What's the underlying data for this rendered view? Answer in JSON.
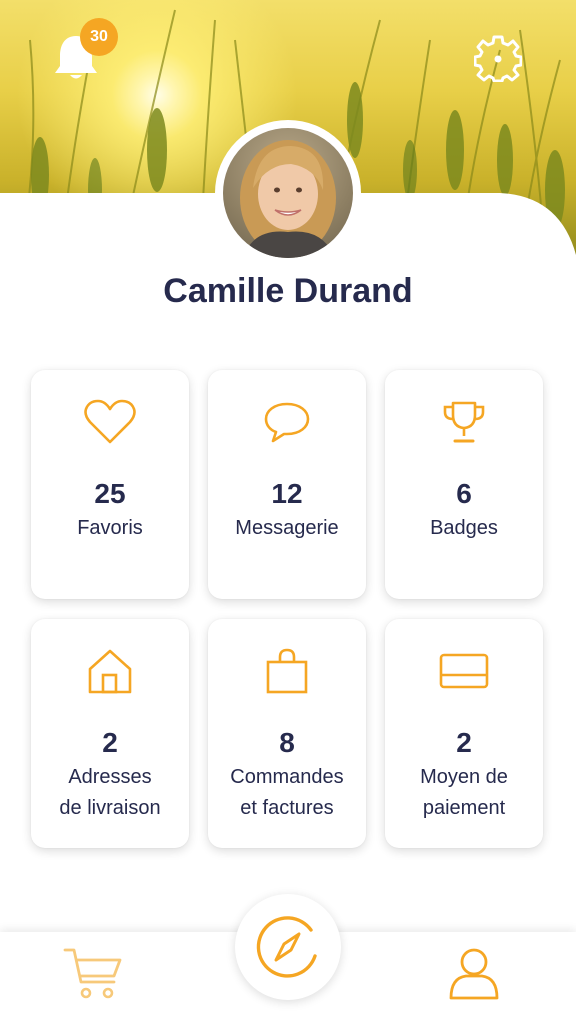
{
  "header": {
    "notifications_count": "30",
    "bell_icon": "bell-icon",
    "settings_icon": "gear-icon"
  },
  "profile": {
    "name": "Camille Durand"
  },
  "stats": [
    {
      "icon": "heart-icon",
      "count": "25",
      "label": "Favoris"
    },
    {
      "icon": "chat-bubble-icon",
      "count": "12",
      "label": "Messagerie"
    },
    {
      "icon": "trophy-icon",
      "count": "6",
      "label": "Badges"
    },
    {
      "icon": "house-icon",
      "count": "2",
      "label_line1": "Adresses",
      "label_line2": "de livraison"
    },
    {
      "icon": "shopping-bag-icon",
      "count": "8",
      "label_line1": "Commandes",
      "label_line2": "et factures"
    },
    {
      "icon": "credit-card-icon",
      "count": "2",
      "label_line1": "Moyen de",
      "label_line2": "paiement"
    }
  ],
  "bottom_nav": {
    "items": [
      "cart-icon",
      "compass-icon",
      "user-icon"
    ]
  },
  "colors": {
    "accent": "#f5a623",
    "text": "#262a4d",
    "card_bg": "#ffffff"
  }
}
